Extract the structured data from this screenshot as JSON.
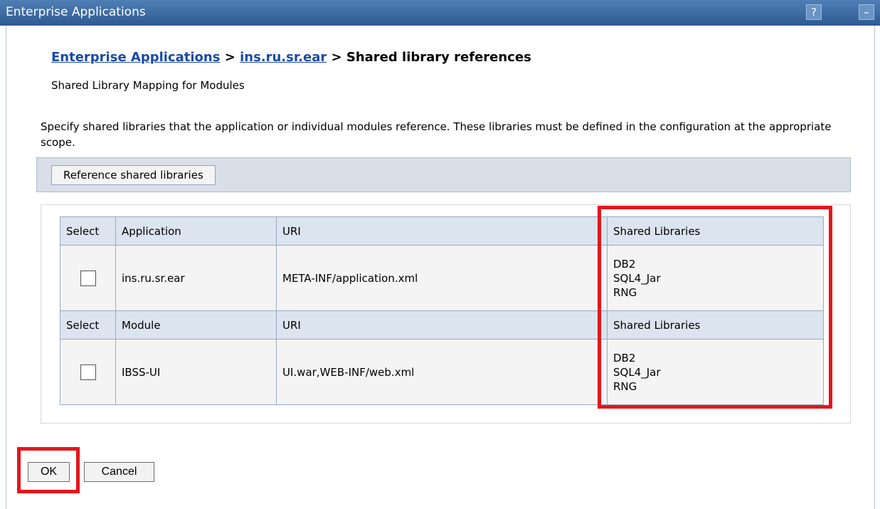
{
  "window": {
    "title": "Enterprise Applications",
    "help_icon": "?",
    "minimize_icon": "–"
  },
  "breadcrumb": {
    "link1": "Enterprise Applications",
    "sep1": " > ",
    "link2": "ins.ru.sr.ear",
    "sep2": " > ",
    "current": "Shared library references"
  },
  "subtitle": "Shared Library Mapping for Modules",
  "description": "Specify shared libraries that the application or individual modules reference. These libraries must be defined in the configuration at the appropriate scope.",
  "toolbar": {
    "reference_button": "Reference shared libraries"
  },
  "table": {
    "app_header": {
      "select": "Select",
      "name": "Application",
      "uri": "URI",
      "libs": "Shared Libraries"
    },
    "app_row": {
      "checked": false,
      "name": "ins.ru.sr.ear",
      "uri": "META-INF/application.xml",
      "libs": [
        "DB2",
        "SQL4_Jar",
        "RNG"
      ]
    },
    "module_header": {
      "select": "Select",
      "name": "Module",
      "uri": "URI",
      "libs": "Shared Libraries"
    },
    "module_row": {
      "checked": false,
      "name": "IBSS-UI",
      "uri": "UI.war,WEB-INF/web.xml",
      "libs": [
        "DB2",
        "SQL4_Jar",
        "RNG"
      ]
    }
  },
  "buttons": {
    "ok": "OK",
    "cancel": "Cancel"
  },
  "colors": {
    "highlight": "#e4161c",
    "link": "#1a4aa6",
    "titlebar": "#2e5a92"
  }
}
